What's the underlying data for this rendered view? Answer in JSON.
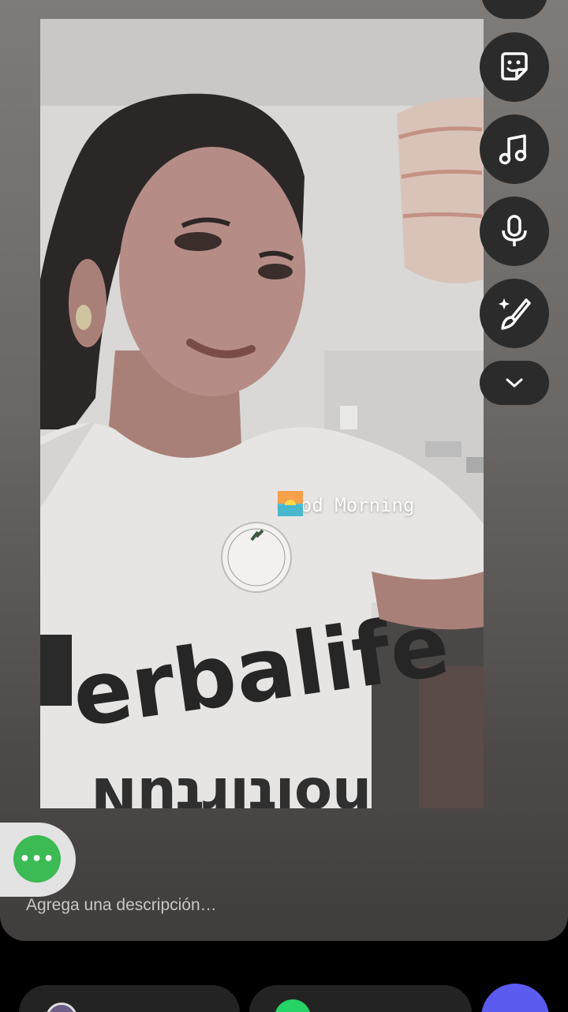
{
  "story": {
    "text_sticker": "Good Morning",
    "emoji": "sunrise"
  },
  "toolbar": {
    "buttons": [
      {
        "name": "sticker-icon"
      },
      {
        "name": "music-note-icon"
      },
      {
        "name": "microphone-icon"
      },
      {
        "name": "magic-brush-icon"
      }
    ],
    "collapse": "chevron-down-icon"
  },
  "composer": {
    "description_placeholder": "Agrega una descripción…",
    "more_icon": "ellipsis-icon"
  },
  "colors": {
    "tool_button_bg": "#2b2b2b",
    "more_button": "#3cba54",
    "send_button": "#5b5bf0"
  }
}
